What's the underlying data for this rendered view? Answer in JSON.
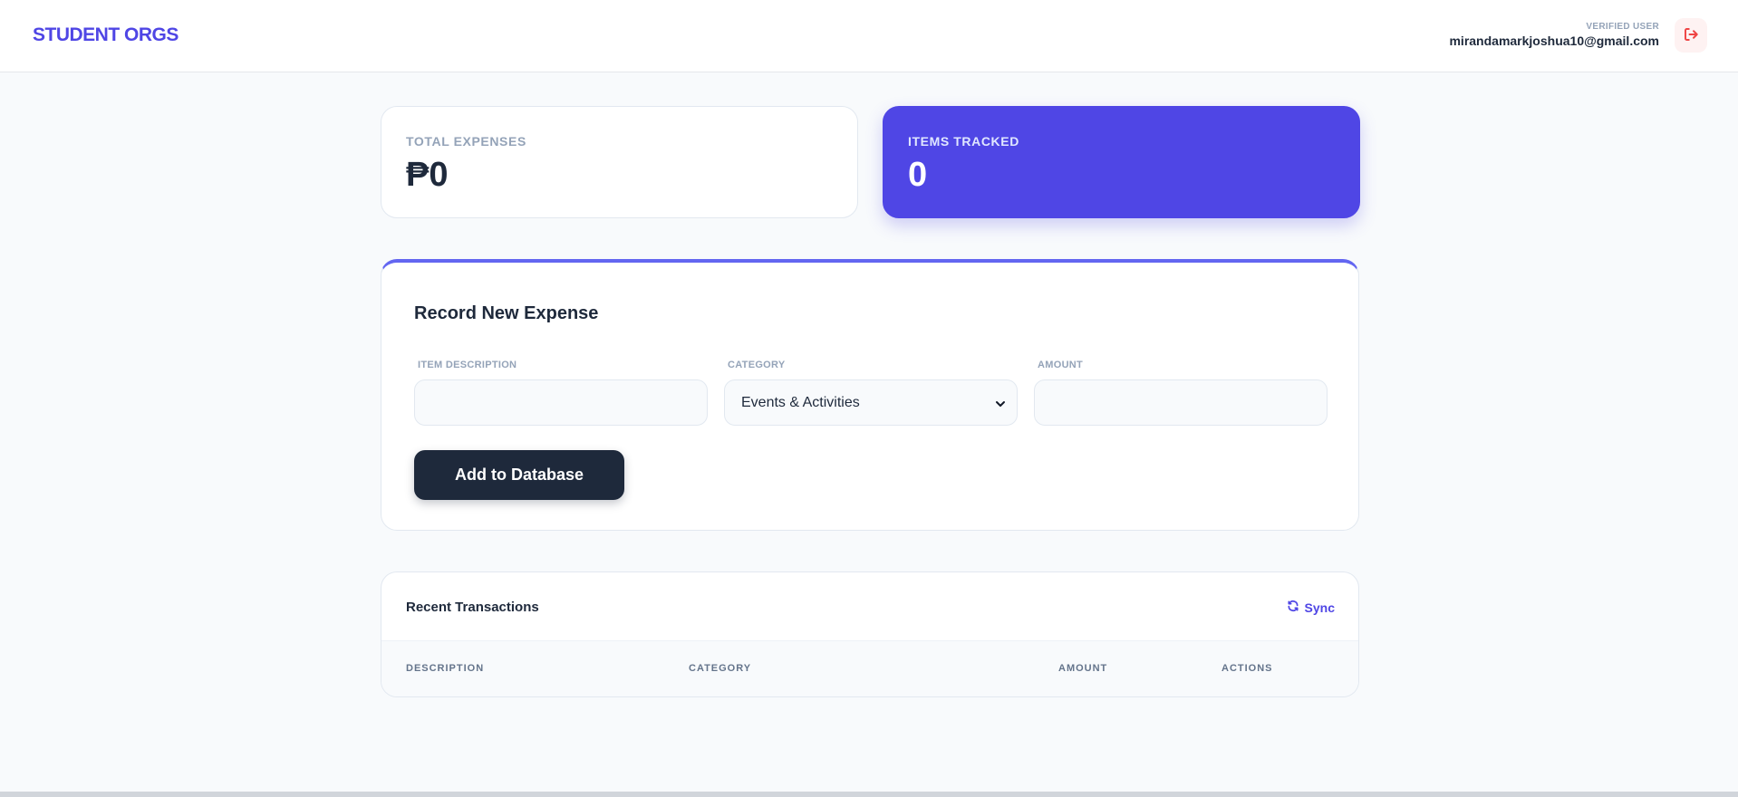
{
  "header": {
    "brand": "STUDENT ORGS",
    "user_role": "VERIFIED USER",
    "user_email": "mirandamarkjoshua10@gmail.com"
  },
  "stats": {
    "total_expenses_label": "TOTAL EXPENSES",
    "total_expenses_value": "₱0",
    "items_tracked_label": "ITEMS TRACKED",
    "items_tracked_value": "0"
  },
  "form": {
    "title": "Record New Expense",
    "description_label": "ITEM DESCRIPTION",
    "description_value": "",
    "category_label": "CATEGORY",
    "category_selected": "Events & Activities",
    "amount_label": "AMOUNT",
    "amount_value": "",
    "submit_label": "Add to Database"
  },
  "transactions": {
    "title": "Recent Transactions",
    "sync_label": "Sync",
    "columns": [
      "DESCRIPTION",
      "CATEGORY",
      "AMOUNT",
      "ACTIONS"
    ],
    "rows": []
  },
  "colors": {
    "brand": "#4f46e5",
    "dark_button": "#1e293b",
    "logout": "#ef4444"
  },
  "icons": {
    "logout": "sign-out-icon",
    "sync": "refresh-icon",
    "select": "chevron-down-icon"
  }
}
